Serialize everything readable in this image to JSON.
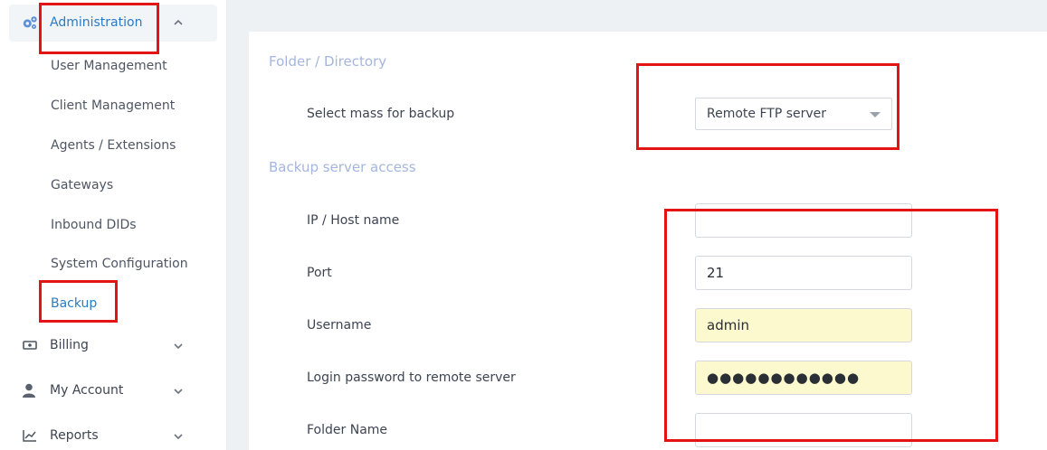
{
  "sidebar": {
    "administration": {
      "label": "Administration",
      "icon": "gears-icon",
      "chevron": "chevron-up-icon"
    },
    "sub_items": [
      {
        "label": "User Management",
        "active": false
      },
      {
        "label": "Client Management",
        "active": false
      },
      {
        "label": "Agents / Extensions",
        "active": false
      },
      {
        "label": "Gateways",
        "active": false
      },
      {
        "label": "Inbound DIDs",
        "active": false
      },
      {
        "label": "System Configuration",
        "active": false
      },
      {
        "label": "Backup",
        "active": true
      }
    ],
    "billing": {
      "label": "Billing",
      "icon": "money-icon"
    },
    "my_account": {
      "label": "My Account",
      "icon": "user-icon"
    },
    "reports": {
      "label": "Reports",
      "icon": "chart-line-icon"
    }
  },
  "main": {
    "folder_section": {
      "title": "Folder / Directory"
    },
    "select_mass": {
      "label": "Select mass for backup",
      "value": "Remote FTP server"
    },
    "access_section": {
      "title": "Backup server access"
    },
    "ip_host": {
      "label": "IP / Host name",
      "value": ""
    },
    "port": {
      "label": "Port",
      "value": "21"
    },
    "username": {
      "label": "Username",
      "value": "admin"
    },
    "password": {
      "label": "Login password to remote server",
      "value": "●●●●●●●●●●●●"
    },
    "folder_name": {
      "label": "Folder Name",
      "value": ""
    }
  },
  "colors": {
    "accent": "#2b7bc4",
    "annotation": "#e51414",
    "section_title": "#a4b6df",
    "autofill": "#fdf9cf"
  }
}
